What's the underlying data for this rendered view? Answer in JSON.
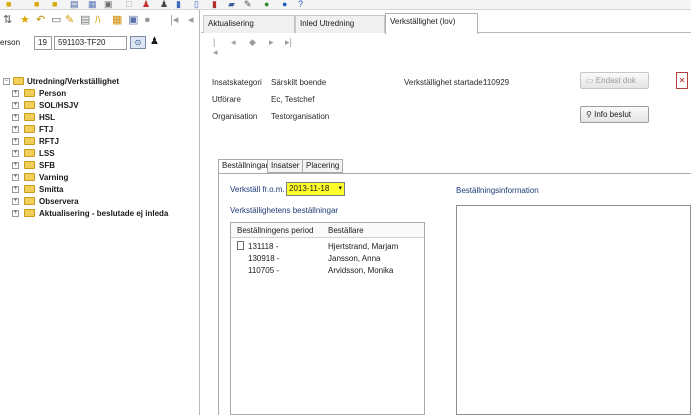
{
  "left": {
    "person_label": "erson",
    "person_num": "19",
    "person_id": "591103-TF20",
    "tree_root": "Utredning/Verkställighet",
    "tree_items": [
      "Person",
      "SOL/HSJV",
      "HSL",
      "FTJ",
      "RFTJ",
      "LSS",
      "SFB",
      "Varning",
      "Smitta",
      "Observera",
      "Aktualisering - beslutade ej inleda"
    ]
  },
  "tabs": [
    "Aktualisering",
    "Inled Utredning",
    "Verkställighet (lov)"
  ],
  "info": {
    "insatskategori_label": "Insatskategori",
    "insatskategori_value": "Särskilt boende",
    "utforare_label": "Utförare",
    "utforare_value": "Ec, Testchef",
    "organisation_label": "Organisation",
    "organisation_value": "Testorganisation",
    "started_label": "Verkställighet startade:",
    "started_value": "110929"
  },
  "buttons": {
    "endast_dok": "Endast dok",
    "info_beslut": "Info beslut"
  },
  "subtabs": [
    "Beställningar",
    "Insatser",
    "Placering"
  ],
  "verkstall": {
    "label": "Verkställ fr.o.m.",
    "date": "2013-11-18"
  },
  "orders_title": "Verkställighetens beställningar",
  "order_info_title": "Beställningsinformation",
  "list": {
    "headers": [
      "Beställningens period",
      "Beställare"
    ],
    "rows": [
      {
        "period": "131118 -",
        "orderer": "Hjertstrand, Marjam"
      },
      {
        "period": "130918 -",
        "orderer": "Jansson, Anna"
      },
      {
        "period": "110705 -",
        "orderer": "Arvidsson, Monika"
      }
    ]
  },
  "colors": {
    "date_field": "#ffff2e",
    "folder": "#f2cf5b"
  }
}
